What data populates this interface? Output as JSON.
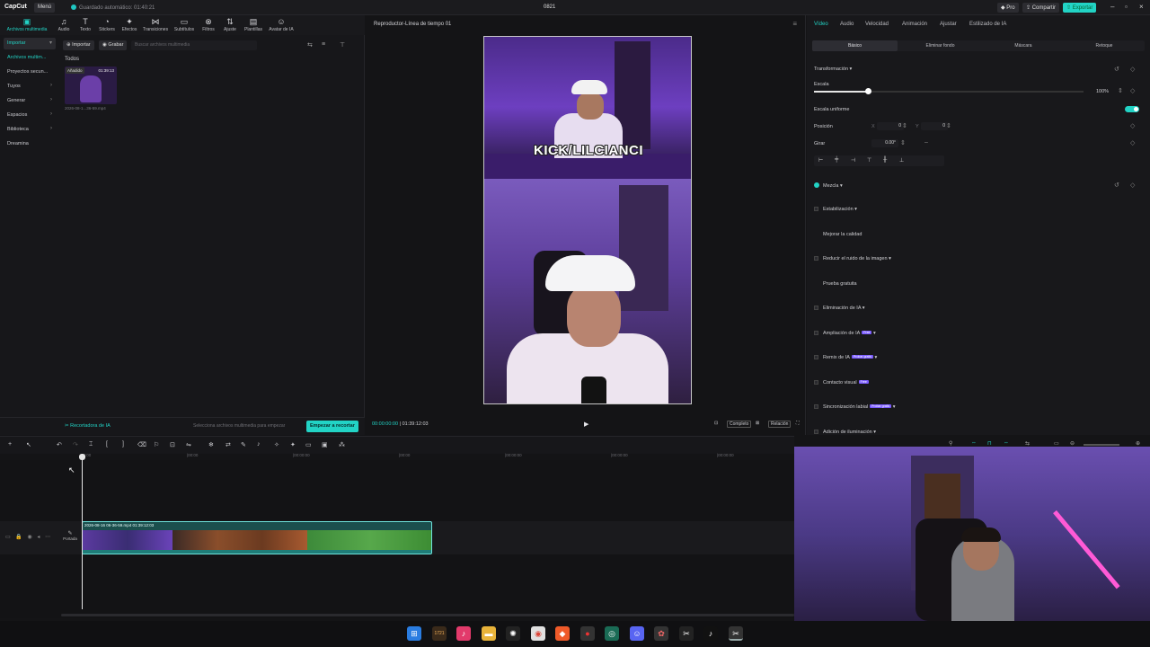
{
  "titlebar": {
    "logo": "CapCut",
    "menu": "Menú",
    "autosave": "Guardado automático: 01:40:21",
    "project_title": "0821",
    "pro": "Pro",
    "share": "Compartir",
    "export": "Exportar"
  },
  "media_toolbar": [
    {
      "icon": "▣",
      "label": "Archivos multimedia"
    },
    {
      "icon": "♫",
      "label": "Audio"
    },
    {
      "icon": "T",
      "label": "Texto"
    },
    {
      "icon": "◔",
      "label": "Stickers"
    },
    {
      "icon": "✦",
      "label": "Efectos"
    },
    {
      "icon": "⋈",
      "label": "Transiciones"
    },
    {
      "icon": "▭",
      "label": "Subtítulos"
    },
    {
      "icon": "⊗",
      "label": "Filtros"
    },
    {
      "icon": "⇅",
      "label": "Ajuste"
    },
    {
      "icon": "▤",
      "label": "Plantillas"
    },
    {
      "icon": "☺",
      "label": "Avatar de IA"
    }
  ],
  "sidebar": {
    "items": [
      "Importar",
      "Archivos multim...",
      "Proyectos secun...",
      "Tuyos",
      "Generar",
      "Espacios",
      "Biblioteca",
      "Dreamina"
    ]
  },
  "media": {
    "import_label": "Importar",
    "record_label": "Grabar",
    "search_placeholder": "Buscar archivos multimedia",
    "section": "Todos",
    "thumb_badge": "Añadido",
    "thumb_duration": "01:39:13",
    "thumb_name": "2026-08-1...36-59.mp4"
  },
  "left_bottom": {
    "recorder": "Recortadora de IA",
    "hint": "Selecciona archivos multimedia para empezar",
    "start": "Empezar a recortar"
  },
  "player": {
    "title": "Reproductor-Línea de tiempo 01",
    "caption": "KICK/LILCIANCI",
    "current_time": "00:00:00:00",
    "total_time": "01:39:12:03",
    "fit_label": "Completo",
    "ratio_label": "Relación"
  },
  "inspector": {
    "tabs": [
      "Vídeo",
      "Audio",
      "Velocidad",
      "Animación",
      "Ajustar",
      "Estilizado de IA"
    ],
    "subtabs": [
      "Básico",
      "Eliminar fondo",
      "Máscara",
      "Retoque"
    ],
    "transform": "Transformación",
    "scale_label": "Escala",
    "scale_value": "100%",
    "scale_fraction": 0.2,
    "uniform_scale": "Escala uniforme",
    "position": "Posición",
    "pos_x_label": "X",
    "pos_x": "0",
    "pos_y_label": "Y",
    "pos_y": "0",
    "rotate": "Girar",
    "rotate_value": "0.00°",
    "mix": "Mezcla",
    "stabilize": "Estabilización",
    "improve": "Mejorar la calidad",
    "noise": "Reducir el ruido de la imagen",
    "free_trial": "Prueba gratuita",
    "ai_removal": "Eliminación de IA",
    "ai_expand": "Ampliación de IA",
    "ai_remix": "Remix de IA",
    "eye_contact": "Contacto visual",
    "lip_sync": "Sincronización labial",
    "lighting": "Adición de iluminación",
    "badge_free": "Free",
    "badge_trial": "Probar gratis"
  },
  "timeline": {
    "ticks": [
      "00:00",
      "|00:00",
      "|00:00:00",
      "|00:00",
      "|00:00:00",
      "|00:00:00",
      "|00:00:00"
    ],
    "cover": "Portada",
    "clip_name": "2026-08-16 06-36-59.mp4   01:39:12:03"
  },
  "taskbar": {
    "icons": [
      "windows-icon",
      "app-1721-icon",
      "tiktok-studio-icon",
      "folder-icon",
      "chatgpt-icon",
      "chrome-icon",
      "brave-icon",
      "app-red-icon",
      "app-green-icon",
      "discord-icon",
      "settings-icon",
      "capcut-icon",
      "tiktok-icon",
      "capcut-active-icon"
    ]
  }
}
